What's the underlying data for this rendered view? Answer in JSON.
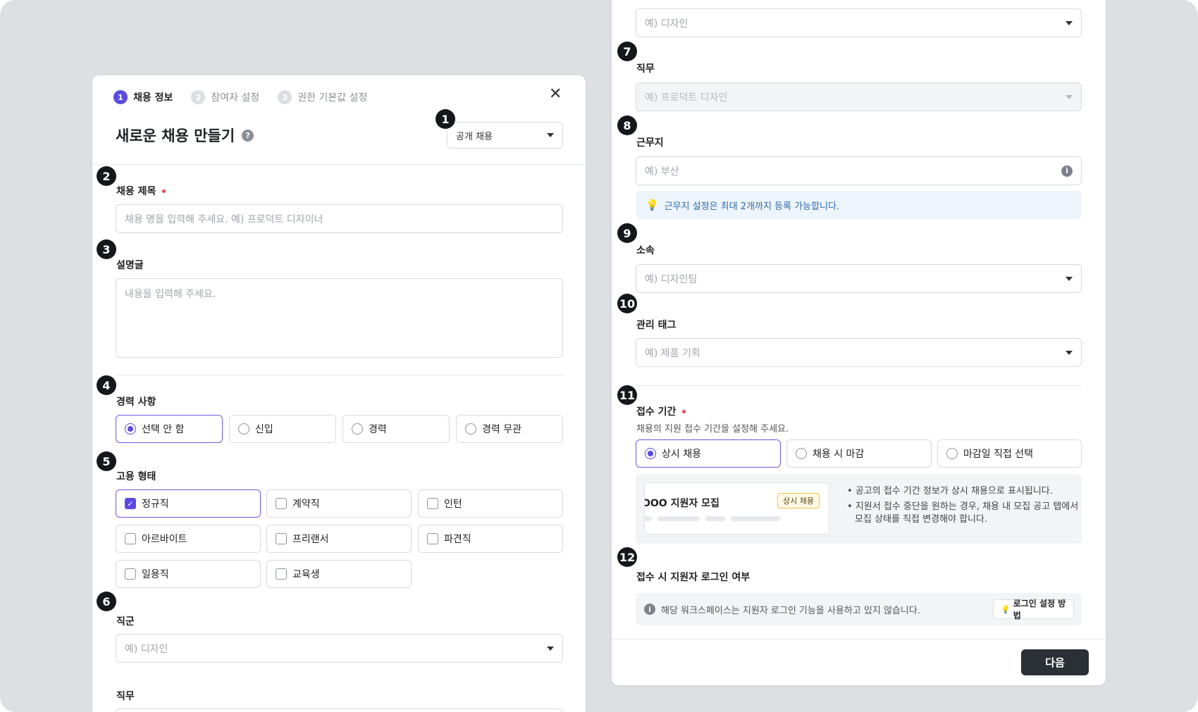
{
  "stepper": [
    {
      "num": "1",
      "label": "채용 정보"
    },
    {
      "num": "2",
      "label": "참여자 설정"
    },
    {
      "num": "3",
      "label": "권한 기본값 설정"
    }
  ],
  "header": {
    "title": "새로운 채용 만들기",
    "help": "?",
    "close": "✕",
    "type_value": "공개 채용"
  },
  "markers": [
    "1",
    "2",
    "3",
    "4",
    "5",
    "6",
    "7",
    "8",
    "9",
    "10",
    "11",
    "12"
  ],
  "job_title": {
    "label": "채용 제목",
    "placeholder": "채용 명을 입력해 주세요. 예) 프로덕트 디자이너"
  },
  "description": {
    "label": "설명글",
    "placeholder": "내용을 입력해 주세요."
  },
  "experience": {
    "label": "경력 사항",
    "options": [
      "선택 안 함",
      "신입",
      "경력",
      "경력 무관"
    ]
  },
  "employment": {
    "label": "고용 형태",
    "options": [
      "정규직",
      "계약직",
      "인턴",
      "아르바이트",
      "프리랜서",
      "파견직",
      "일용직",
      "교육생"
    ]
  },
  "job_group": {
    "label": "직군",
    "placeholder": "예) 디자인"
  },
  "job_role_left": {
    "label": "직무"
  },
  "right": {
    "job_group_placeholder": "예) 디자인",
    "job_role": {
      "label": "직무",
      "placeholder": "예) 프로덕트 디자인"
    },
    "location": {
      "label": "근무지",
      "placeholder": "예) 부산",
      "info": "i",
      "tip": "근무지 설정은 최대 2개까지 등록 가능합니다.",
      "tip_icon": "💡"
    },
    "affiliation": {
      "label": "소속",
      "placeholder": "예) 디자인팀"
    },
    "tags": {
      "label": "관리 태그",
      "placeholder": "예) 제품 기획"
    },
    "period": {
      "label": "접수 기간",
      "desc": "채용의 지원 접수 기간을 설정해 주세요.",
      "options": [
        "상시 채용",
        "채용 시 마감",
        "마감일 직접 선택"
      ],
      "preview_title": "OOO 지원자 모집",
      "preview_badge": "상시 채용",
      "bullets": [
        "공고의 접수 기간 정보가 상시 채용으로 표시됩니다.",
        "지원서 접수 중단을 원하는 경우, 채용 내 모집 공고 탭에서",
        "모집 상태를 직접 변경해야 합니다."
      ]
    },
    "login": {
      "label": "접수 시 지원자 로그인 여부",
      "info": "i",
      "text": "해당 워크스페이스는 지원자 로그인 기능을 사용하고 있지 않습니다.",
      "button": "로그인 설정 방법",
      "button_icon": "💡"
    },
    "next": "다음"
  },
  "colors": {
    "accent": "#5b4be2",
    "background": "#dddfe3",
    "required": "#e5484d",
    "primary_button": "#2b2f36"
  }
}
